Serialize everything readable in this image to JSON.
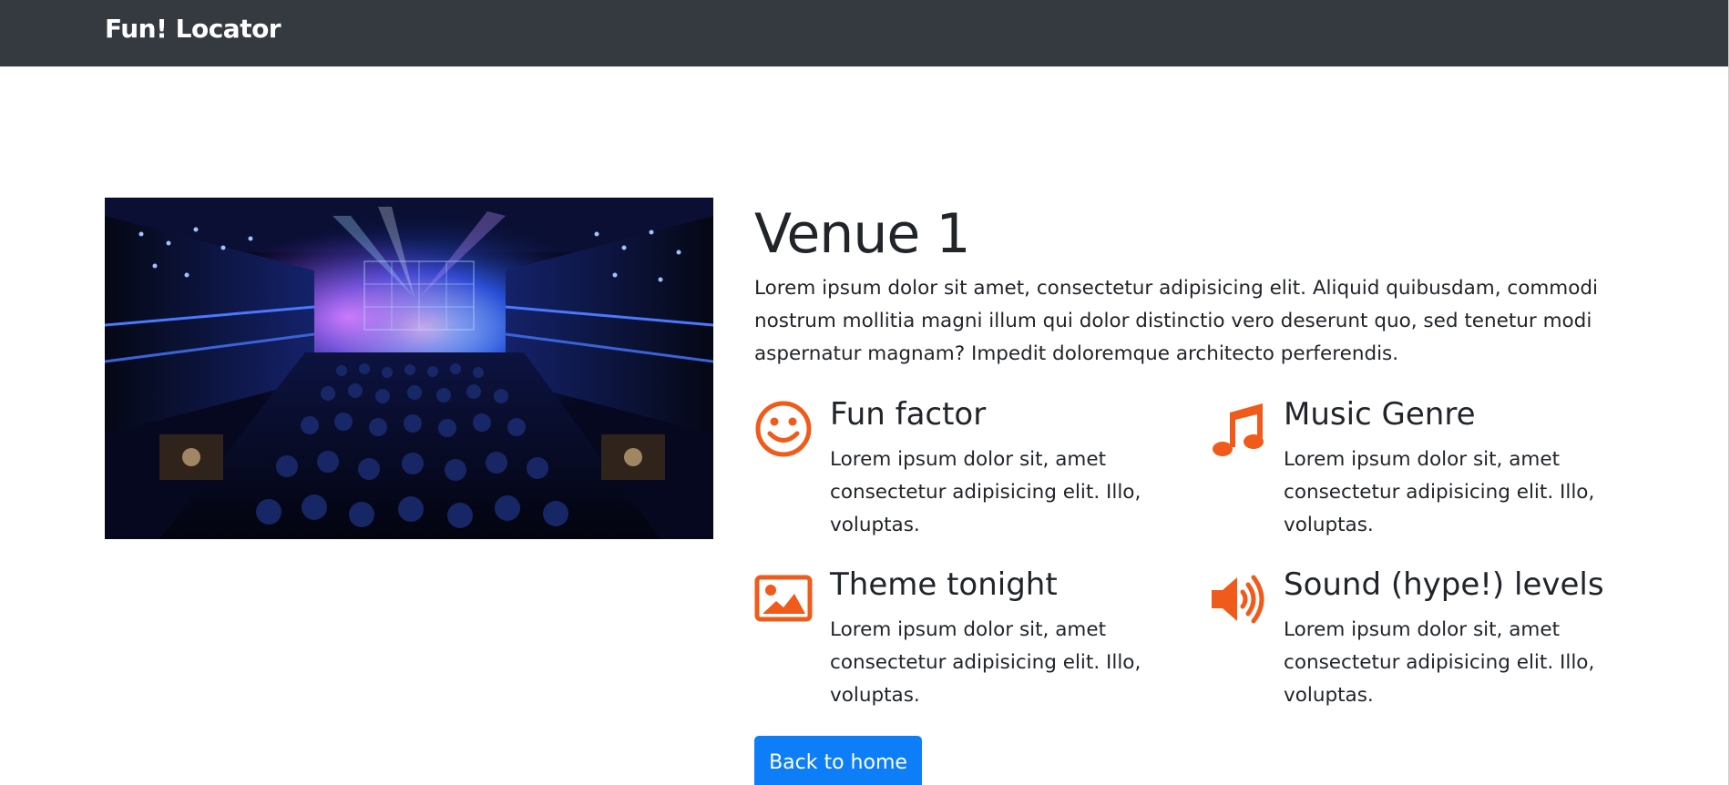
{
  "navbar": {
    "brand": "Fun! Locator"
  },
  "venue": {
    "title": "Venue 1",
    "description": "Lorem ipsum dolor sit amet, consectetur adipisicing elit. Aliquid quibusdam, commodi nostrum mollitia magni illum qui dolor distinctio vero deserunt quo, sed tenetur modi aspernatur magnam? Impedit doloremque architecto perferendis.",
    "image_alt": "Concert venue with crowd and stage lights"
  },
  "features": [
    {
      "icon": "smile-icon",
      "title": "Fun factor",
      "text": "Lorem ipsum dolor sit, amet consectetur adipisicing elit. Illo, voluptas."
    },
    {
      "icon": "music-note-icon",
      "title": "Music Genre",
      "text": "Lorem ipsum dolor sit, amet consectetur adipisicing elit. Illo, voluptas."
    },
    {
      "icon": "image-icon",
      "title": "Theme tonight",
      "text": "Lorem ipsum dolor sit, amet consectetur adipisicing elit. Illo, voluptas."
    },
    {
      "icon": "volume-up-icon",
      "title": "Sound (hype!) levels",
      "text": "Lorem ipsum dolor sit, amet consectetur adipisicing elit. Illo, voluptas."
    }
  ],
  "actions": {
    "back_label": "Back to home"
  },
  "colors": {
    "navbar": "#343a40",
    "icon_accent": "#f05a1a",
    "button_primary": "#0d7ef7",
    "text": "#212529"
  }
}
